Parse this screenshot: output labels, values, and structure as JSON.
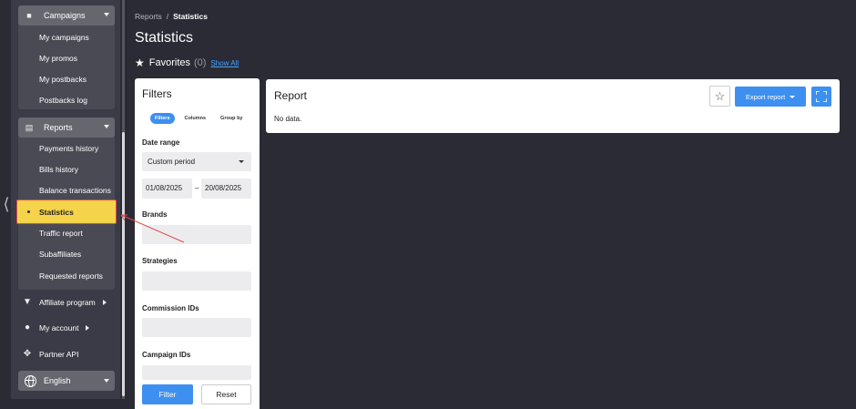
{
  "sidebar": {
    "campaigns": {
      "label": "Campaigns",
      "items": [
        "My campaigns",
        "My promos",
        "My postbacks",
        "Postbacks log"
      ]
    },
    "reports": {
      "label": "Reports",
      "items": [
        "Payments history",
        "Bills history",
        "Balance transactions",
        "Statistics",
        "Traffic report",
        "Subaffiliates",
        "Requested reports"
      ]
    },
    "affiliate_program": "Affiliate program",
    "my_account": "My account",
    "partner_api": "Partner API",
    "language": "English"
  },
  "breadcrumb": {
    "parent": "Reports",
    "separator": "/",
    "current": "Statistics"
  },
  "page_title": "Statistics",
  "favorites": {
    "label": "Favorites",
    "count": "(0)",
    "show_all": "Show All"
  },
  "filters": {
    "title": "Filters",
    "tabs": [
      "Filters",
      "Columns",
      "Group by"
    ],
    "date_range_label": "Date range",
    "period": "Custom period",
    "date_from": "01/08/2025",
    "date_sep": "–",
    "date_to": "20/08/2025",
    "brands_label": "Brands",
    "strategies_label": "Strategies",
    "commission_label": "Commission IDs",
    "campaign_label": "Campaign IDs",
    "filter_btn": "Filter",
    "reset_btn": "Reset"
  },
  "report": {
    "title": "Report",
    "no_data": "No data.",
    "export_btn": "Export report"
  },
  "colors": {
    "accent": "#3d8ff0",
    "highlight": "#f5d34b",
    "annotation": "#e04a4a",
    "sidebar_bg": "#3b3b47",
    "page_bg": "#2b2b36"
  }
}
